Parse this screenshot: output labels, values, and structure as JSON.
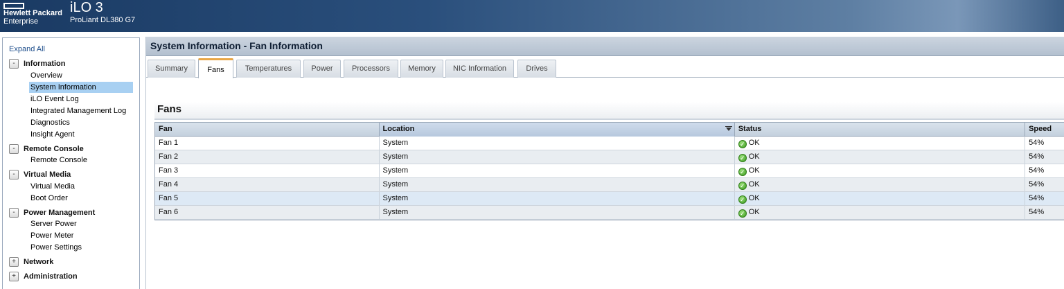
{
  "header": {
    "brand": [
      "Hewlett Packard",
      "Enterprise"
    ],
    "product": "iLO 3",
    "model": "ProLiant DL380 G7"
  },
  "sidebar": {
    "expand_all": "Expand All",
    "groups": [
      {
        "label": "Information",
        "toggle": "-",
        "items": [
          "Overview",
          "System Information",
          "iLO Event Log",
          "Integrated Management Log",
          "Diagnostics",
          "Insight Agent"
        ]
      },
      {
        "label": "Remote Console",
        "toggle": "-",
        "items": [
          "Remote Console"
        ]
      },
      {
        "label": "Virtual Media",
        "toggle": "-",
        "items": [
          "Virtual Media",
          "Boot Order"
        ]
      },
      {
        "label": "Power Management",
        "toggle": "-",
        "items": [
          "Server Power",
          "Power Meter",
          "Power Settings"
        ]
      },
      {
        "label": "Network",
        "toggle": "+",
        "items": []
      },
      {
        "label": "Administration",
        "toggle": "+",
        "items": []
      }
    ],
    "selected_item": "System Information"
  },
  "page": {
    "title": "System Information - Fan Information",
    "tabs": [
      "Summary",
      "Fans",
      "Temperatures",
      "Power",
      "Processors",
      "Memory",
      "NIC Information",
      "Drives"
    ],
    "active_tab": "Fans",
    "section_title": "Fans"
  },
  "table": {
    "columns": [
      "Fan",
      "Location",
      "Status",
      "Speed"
    ],
    "sorted_column": "Location",
    "rows": [
      {
        "fan": "Fan 1",
        "location": "System",
        "status": "OK",
        "speed": "54%"
      },
      {
        "fan": "Fan 2",
        "location": "System",
        "status": "OK",
        "speed": "54%"
      },
      {
        "fan": "Fan 3",
        "location": "System",
        "status": "OK",
        "speed": "54%"
      },
      {
        "fan": "Fan 4",
        "location": "System",
        "status": "OK",
        "speed": "54%"
      },
      {
        "fan": "Fan 5",
        "location": "System",
        "status": "OK",
        "speed": "54%"
      },
      {
        "fan": "Fan 6",
        "location": "System",
        "status": "OK",
        "speed": "54%"
      }
    ],
    "highlighted_row": 4
  },
  "colors": {
    "header_dark": "#1a3a63",
    "selected_item": "#a8d0f2",
    "active_tab_accent": "#e9a645",
    "status_ok": "#3a9a1e"
  },
  "icons": {
    "status_ok": "ok-check-icon",
    "sort": "sort-descending-icon"
  }
}
